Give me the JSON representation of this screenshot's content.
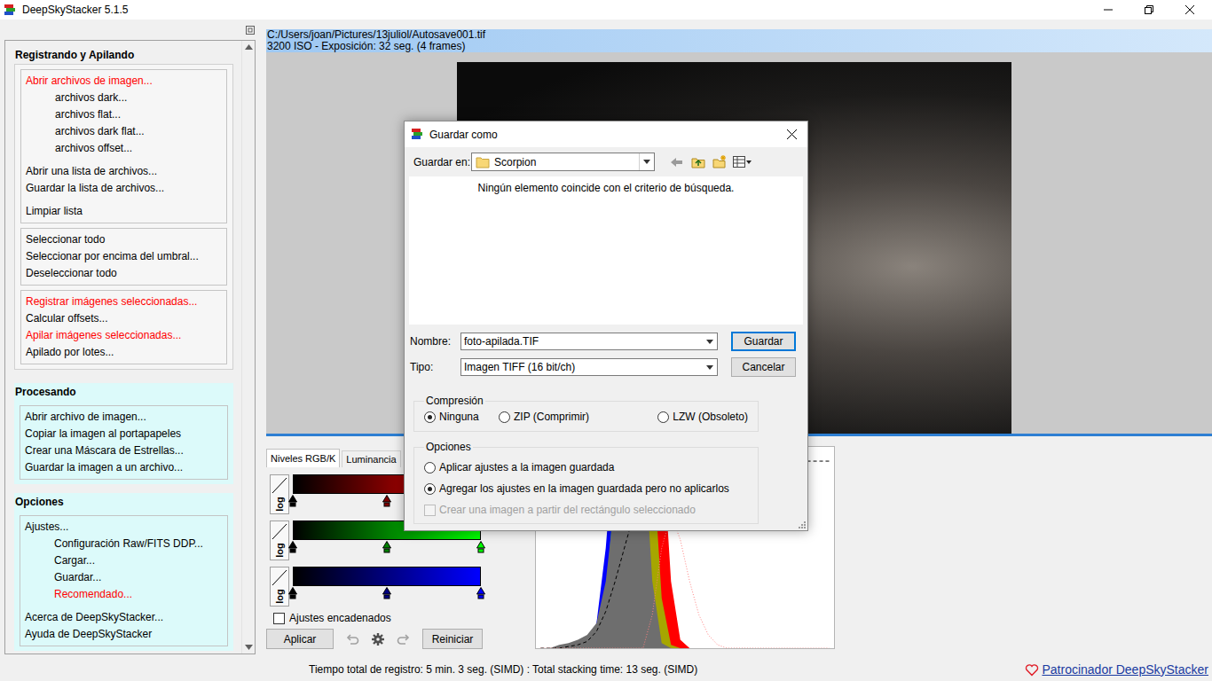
{
  "window": {
    "title": "DeepSkyStacker 5.1.5"
  },
  "sidebar": {
    "sections": [
      {
        "title": "Registrando y Apilando",
        "kind": "neutral",
        "groups": [
          [
            [
              {
                "label": "Abrir archivos de imagen...",
                "kind": "main",
                "color": "#ff0000"
              },
              {
                "label": "archivos dark...",
                "kind": "sub",
                "color": "#000000"
              },
              {
                "label": "archivos flat...",
                "kind": "sub",
                "color": "#000000"
              },
              {
                "label": "archivos dark flat...",
                "kind": "sub",
                "color": "#000000"
              },
              {
                "label": "archivos offset...",
                "kind": "sub",
                "color": "#000000"
              }
            ],
            [
              {
                "label": "Abrir una lista de archivos...",
                "kind": "main",
                "color": "#000000"
              },
              {
                "label": "Guardar la lista de archivos...",
                "kind": "main",
                "color": "#000000"
              }
            ],
            [
              {
                "label": "Limpiar lista",
                "kind": "main",
                "color": "#000000"
              }
            ]
          ],
          [
            [
              {
                "label": "Seleccionar todo",
                "kind": "main",
                "color": "#000000"
              },
              {
                "label": "Seleccionar por encima del umbral...",
                "kind": "main",
                "color": "#000000"
              },
              {
                "label": "Deseleccionar todo",
                "kind": "main",
                "color": "#000000"
              }
            ]
          ],
          [
            [
              {
                "label": "Registrar imágenes seleccionadas...",
                "kind": "main",
                "color": "#ff0000"
              },
              {
                "label": "Calcular offsets...",
                "kind": "main",
                "color": "#000000"
              },
              {
                "label": "Apilar imágenes seleccionadas...",
                "kind": "main",
                "color": "#ff0000"
              },
              {
                "label": "Apilado por lotes...",
                "kind": "main",
                "color": "#000000"
              }
            ]
          ]
        ]
      },
      {
        "title": "Procesando",
        "kind": "tinted",
        "groups": [
          [
            [
              {
                "label": "Abrir archivo de imagen...",
                "kind": "main",
                "color": "#000000"
              },
              {
                "label": "Copiar la imagen al portapapeles",
                "kind": "main",
                "color": "#000000"
              },
              {
                "label": "Crear una Máscara de Estrellas...",
                "kind": "main",
                "color": "#000000"
              },
              {
                "label": "Guardar la imagen a un archivo...",
                "kind": "main",
                "color": "#000000"
              }
            ]
          ]
        ]
      },
      {
        "title": "Opciones",
        "kind": "tinted",
        "groups": [
          [
            [
              {
                "label": "Ajustes...",
                "kind": "main",
                "color": "#000000"
              },
              {
                "label": "Configuración Raw/FITS DDP...",
                "kind": "sub",
                "color": "#000000"
              },
              {
                "label": "Cargar...",
                "kind": "sub",
                "color": "#000000"
              },
              {
                "label": "Guardar...",
                "kind": "sub",
                "color": "#000000"
              },
              {
                "label": "Recomendado...",
                "kind": "sub",
                "color": "#ff0000"
              }
            ],
            [
              {
                "label": "Acerca de DeepSkyStacker...",
                "kind": "main",
                "color": "#000000"
              },
              {
                "label": "Ayuda de DeepSkyStacker",
                "kind": "main",
                "color": "#000000"
              }
            ]
          ]
        ]
      }
    ]
  },
  "path_bar": {
    "file": "C:/Users/joan/Pictures/13juliol/Autosave001.tif",
    "info": "3200 ISO - Exposición: 32 seg. (4 frames)"
  },
  "levels": {
    "tabs": [
      {
        "label": "Niveles RGB/K",
        "selected": true
      },
      {
        "label": "Luminancia",
        "selected": false
      }
    ],
    "channels": [
      {
        "color": "#ff0000",
        "log_label": "log",
        "markers": [
          0,
          0.5,
          1
        ]
      },
      {
        "color": "#00ff00",
        "log_label": "log",
        "markers": [
          0,
          0.5,
          1
        ]
      },
      {
        "color": "#0000ff",
        "log_label": "log",
        "markers": [
          0,
          0.5,
          1
        ]
      }
    ],
    "chained": {
      "label": "Ajustes encadenados",
      "checked": false
    },
    "buttons": {
      "apply": "Aplicar",
      "reset": "Reiniciar"
    },
    "undo": {
      "disabled": true
    },
    "redo": {
      "disabled": true
    }
  },
  "histogram": {
    "series": [
      {
        "kind": "area",
        "color": "#ff0000",
        "values": [
          0,
          0,
          0,
          0,
          0,
          0,
          0,
          0,
          0,
          0,
          0.1,
          0.7,
          1.6,
          1.3,
          0.4,
          0.05,
          0,
          0,
          0,
          0,
          0,
          0,
          0,
          0,
          0,
          0,
          0,
          0,
          0,
          0,
          0,
          0
        ]
      },
      {
        "kind": "area",
        "color": "#a6a600",
        "values": [
          0,
          0,
          0,
          0,
          0,
          0,
          0,
          0,
          0,
          0.2,
          0.9,
          1.5,
          1.2,
          0.3,
          0.02,
          0,
          0,
          0,
          0,
          0,
          0,
          0,
          0,
          0,
          0,
          0,
          0,
          0,
          0,
          0,
          0,
          0
        ]
      },
      {
        "kind": "area",
        "color": "#0000ff",
        "values": [
          0,
          0,
          0,
          0,
          0,
          0.03,
          0.15,
          0.6,
          1.3,
          1.5,
          0.8,
          0.1,
          0,
          0,
          0,
          0,
          0,
          0,
          0,
          0,
          0,
          0,
          0,
          0,
          0,
          0,
          0,
          0,
          0,
          0,
          0,
          0
        ]
      },
      {
        "kind": "area",
        "color": "#1a9a9a",
        "values": [
          0,
          0,
          0,
          0,
          0,
          0,
          0.04,
          0.3,
          1.0,
          1.5,
          1.4,
          0.5,
          0.05,
          0,
          0,
          0,
          0,
          0,
          0,
          0,
          0,
          0,
          0,
          0,
          0,
          0,
          0,
          0,
          0,
          0,
          0,
          0
        ]
      },
      {
        "kind": "area",
        "color": "#6e6e6e",
        "values": [
          0,
          0,
          0.02,
          0.03,
          0.05,
          0.08,
          0.15,
          0.4,
          0.9,
          1.5,
          1.6,
          1.3,
          0.4,
          0.03,
          0,
          0,
          0,
          0,
          0,
          0,
          0,
          0,
          0,
          0,
          0,
          0,
          0,
          0,
          0,
          0,
          0,
          0
        ]
      },
      {
        "kind": "dashed",
        "color": "#000000",
        "values": [
          0,
          0,
          0,
          0.01,
          0.02,
          0.04,
          0.1,
          0.22,
          0.4,
          0.6,
          0.8,
          0.95,
          1.05,
          1.1,
          1.12,
          1.12,
          1.12,
          1.12,
          1.12,
          1.12,
          1.12,
          1.12,
          1.12,
          1.12,
          1.12,
          1.12,
          1.12,
          1.12,
          1.12,
          1.12,
          1.12,
          1.12
        ]
      },
      {
        "kind": "dotted",
        "color": "#ff8080",
        "values": [
          0,
          0,
          0,
          0,
          0,
          0,
          0,
          0,
          0,
          0,
          0,
          0,
          0.2,
          0.6,
          0.8,
          0.65,
          0.4,
          0.2,
          0.08,
          0.02,
          0,
          0,
          0,
          0,
          0,
          0,
          0,
          0,
          0,
          0,
          0,
          0
        ]
      }
    ]
  },
  "status_bar": {
    "text": "Tiempo total de registro: 5 min. 3 seg. (SIMD) : Total stacking time: 13 seg. (SIMD)",
    "sponsor": "Patrocinador DeepSkyStacker"
  },
  "dialog": {
    "title": "Guardar como",
    "save_in_label": "Guardar en:",
    "folder": "Scorpion",
    "empty_message": "Ningún elemento coincide con el criterio de búsqueda.",
    "fields": [
      {
        "label": "Nombre:",
        "value": "foto-apilada.TIF",
        "button": "Guardar",
        "default": true
      },
      {
        "label": "Tipo:",
        "value": "Imagen TIFF (16 bit/ch)",
        "button": "Cancelar",
        "default": false
      }
    ],
    "compression": {
      "legend": "Compresión",
      "options": [
        {
          "label": "Ninguna",
          "selected": true
        },
        {
          "label": "ZIP (Comprimir)",
          "selected": false
        },
        {
          "label": "LZW (Obsoleto)",
          "selected": false
        }
      ]
    },
    "options": {
      "legend": "Opciones",
      "items": [
        {
          "kind": "radio",
          "label": "Aplicar ajustes a la imagen guardada",
          "selected": false,
          "disabled": false
        },
        {
          "kind": "radio",
          "label": "Agregar los ajustes en la imagen guardada pero no aplicarlos",
          "selected": true,
          "disabled": false
        },
        {
          "kind": "checkbox",
          "label": "Crear una imagen a partir del rectángulo seleccionado",
          "checked": false,
          "disabled": true
        }
      ]
    }
  }
}
